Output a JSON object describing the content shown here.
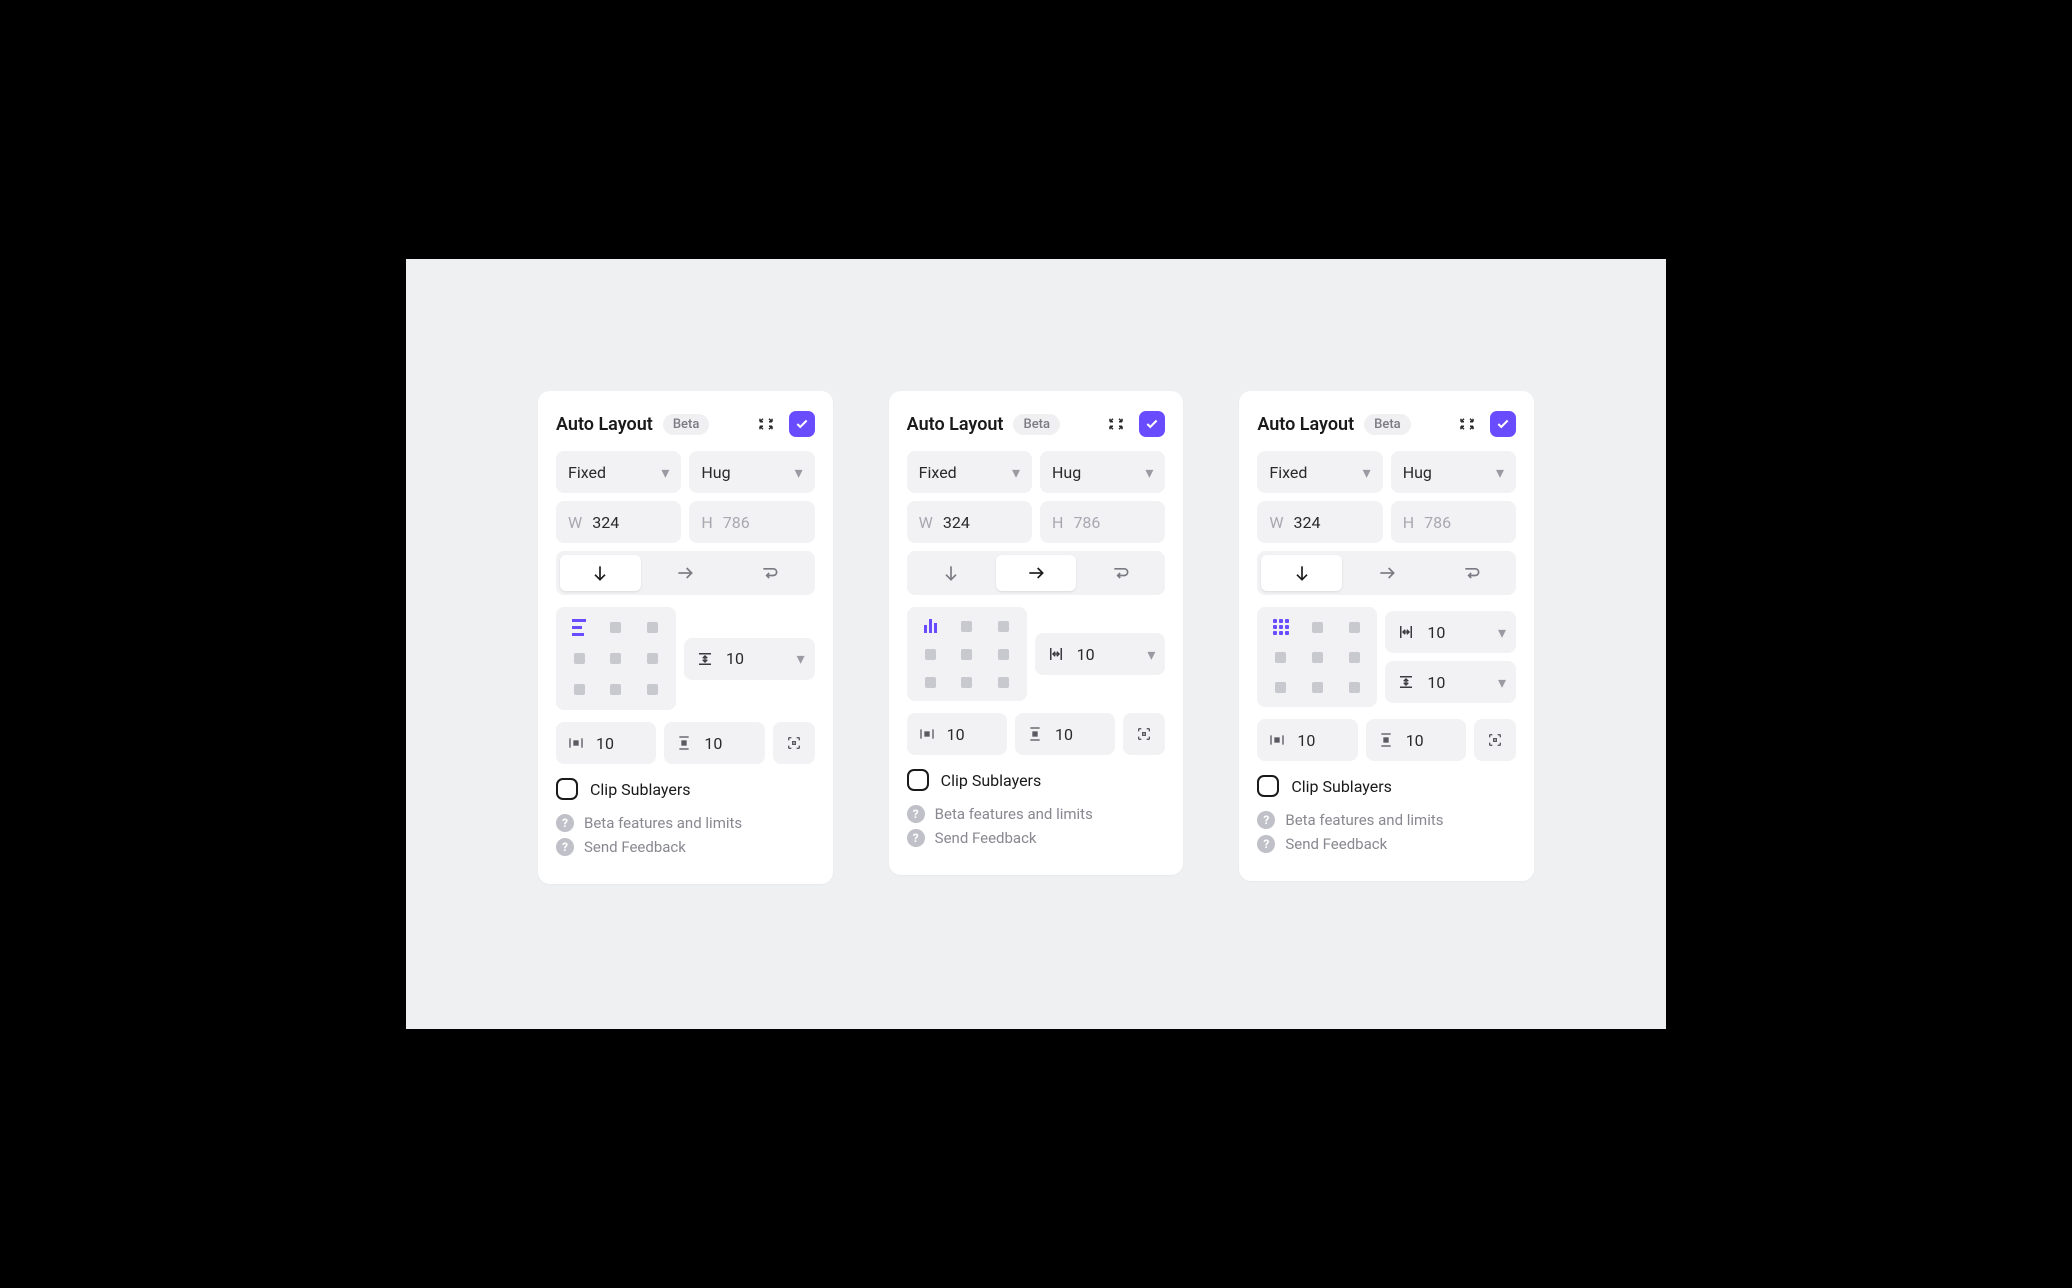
{
  "panels": [
    {
      "title": "Auto Layout",
      "badge": "Beta",
      "widthMode": "Fixed",
      "heightMode": "Hug",
      "w": "324",
      "h": "786",
      "direction": "down",
      "alignIcon": "lines-h",
      "gaps": [
        {
          "icon": "gap-v",
          "value": "10"
        }
      ],
      "padH": "10",
      "padV": "10",
      "clipLabel": "Clip Sublayers",
      "betaLink": "Beta features and limits",
      "feedbackLink": "Send Feedback"
    },
    {
      "title": "Auto Layout",
      "badge": "Beta",
      "widthMode": "Fixed",
      "heightMode": "Hug",
      "w": "324",
      "h": "786",
      "direction": "right",
      "alignIcon": "lines-v",
      "gaps": [
        {
          "icon": "gap-h",
          "value": "10"
        }
      ],
      "padH": "10",
      "padV": "10",
      "clipLabel": "Clip Sublayers",
      "betaLink": "Beta features and limits",
      "feedbackLink": "Send Feedback"
    },
    {
      "title": "Auto Layout",
      "badge": "Beta",
      "widthMode": "Fixed",
      "heightMode": "Hug",
      "w": "324",
      "h": "786",
      "direction": "down",
      "alignIcon": "dots",
      "gaps": [
        {
          "icon": "gap-h",
          "value": "10"
        },
        {
          "icon": "gap-v",
          "value": "10"
        }
      ],
      "padH": "10",
      "padV": "10",
      "clipLabel": "Clip Sublayers",
      "betaLink": "Beta features and limits",
      "feedbackLink": "Send Feedback"
    }
  ],
  "labels": {
    "W": "W",
    "H": "H"
  }
}
